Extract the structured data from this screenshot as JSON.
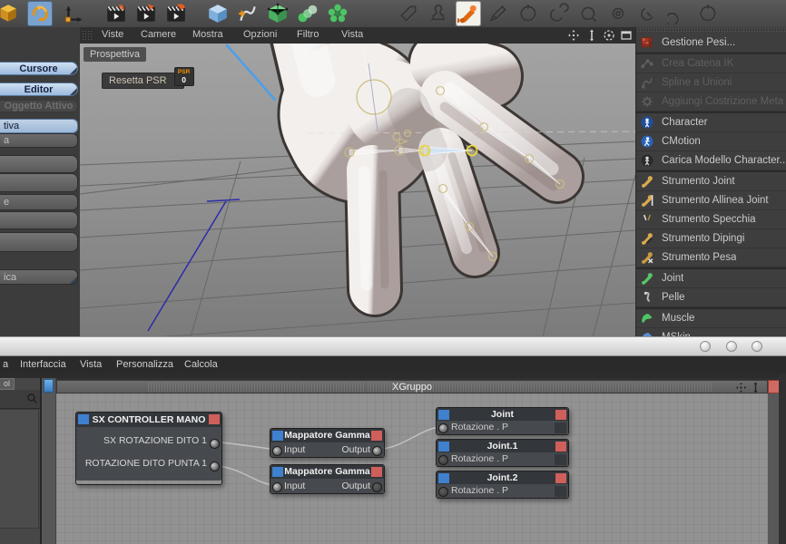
{
  "colors": {
    "accent_blue": "#3f80cf",
    "accent_red": "#cf5f5a",
    "selection_yellow": "#e8d23c",
    "ik_blue": "#4aa0e8"
  },
  "toolbar": {
    "left_icons": [
      {
        "name": "polygon-mode-icon",
        "icon": "ycube"
      },
      {
        "name": "rotate-tool-icon",
        "icon": "rotate",
        "selected": true
      },
      {
        "name": "move-axis-tool-icon",
        "icon": "move"
      },
      {
        "name": "record-position-icon",
        "icon": "clap1"
      },
      {
        "name": "record-scale-icon",
        "icon": "clap2"
      },
      {
        "name": "record-rotation-icon",
        "icon": "clap3"
      },
      {
        "name": "cube-primitive-icon",
        "icon": "bcube"
      },
      {
        "name": "add-spline-icon",
        "icon": "spline"
      },
      {
        "name": "hypernurbs-icon",
        "icon": "cage"
      },
      {
        "name": "array-object-icon",
        "icon": "array"
      },
      {
        "name": "cluster-object-icon",
        "icon": "cluster"
      }
    ],
    "right_icons": [
      {
        "name": "pose-tag-icon",
        "icon": "tag"
      },
      {
        "name": "morph-tag-icon",
        "icon": "stamp"
      },
      {
        "name": "joint-tool-active-icon",
        "icon": "bonew",
        "selected_white": true
      },
      {
        "name": "pencil-tool-icon",
        "icon": "pencil"
      },
      {
        "name": "circle-tool-1-icon",
        "icon": "c1"
      },
      {
        "name": "circle-tool-2-icon",
        "icon": "c2"
      },
      {
        "name": "circle-tool-3-icon",
        "icon": "c3"
      },
      {
        "name": "ring-tool-1-icon",
        "icon": "r1"
      },
      {
        "name": "ring-tool-2-icon",
        "icon": "r2"
      },
      {
        "name": "ring-tool-3-icon",
        "icon": "r3"
      },
      {
        "name": "ring-tool-4-icon",
        "icon": "c1"
      }
    ]
  },
  "left_panel": {
    "buttons": [
      {
        "label": "Cursore",
        "kind": "blue",
        "fold": true
      },
      {
        "label": "Editor",
        "kind": "blue",
        "fold": true
      },
      {
        "label": "Oggetto Attivo",
        "kind": "dis"
      },
      {
        "label": "tiva",
        "kind": "sel"
      },
      {
        "label": "a",
        "kind": "row"
      },
      {
        "label": "",
        "kind": "empty"
      },
      {
        "label": "",
        "kind": "empty"
      },
      {
        "label": "e",
        "kind": "row"
      },
      {
        "label": "",
        "kind": "empty"
      },
      {
        "label": "",
        "kind": "empty"
      },
      {
        "label": "ica",
        "kind": "row",
        "fold": true
      }
    ]
  },
  "viewport": {
    "menu": [
      "Viste",
      "Camere",
      "Mostra",
      "Opzioni",
      "Filtro",
      "Vista"
    ],
    "nav_icons": [
      "pan-view-icon",
      "zoom-view-icon",
      "rotate-view-icon",
      "maximize-view-icon"
    ],
    "view_label": "Prospettiva",
    "reset_button": {
      "label": "Resetta PSR",
      "badge_top": "PSR",
      "badge_bottom": "0"
    }
  },
  "sidebar": {
    "items": [
      {
        "label": "Gestione Pesi...",
        "icon": "weights-grid-icon",
        "group_end": true
      },
      {
        "label": "Crea Catena IK",
        "icon": "ik-chain-icon",
        "disabled": true
      },
      {
        "label": "Spline a Unioni",
        "icon": "spline-union-icon",
        "disabled": true
      },
      {
        "label": "Aggiungi Costrizione Meta",
        "icon": "constraint-gear-icon",
        "disabled": true,
        "group_end": true
      },
      {
        "label": "Character",
        "icon": "character-circle-icon"
      },
      {
        "label": "CMotion",
        "icon": "cmotion-circle-icon"
      },
      {
        "label": "Carica Modello Character...",
        "icon": "character-model-icon",
        "group_end": true
      },
      {
        "label": "Strumento Joint",
        "icon": "joint-tool-icon"
      },
      {
        "label": "Strumento Allinea Joint",
        "icon": "joint-align-icon"
      },
      {
        "label": "Strumento Specchia",
        "icon": "mirror-tool-icon"
      },
      {
        "label": "Strumento Dipingi",
        "icon": "paint-tool-icon"
      },
      {
        "label": "Strumento Pesa",
        "icon": "weight-tool-icon",
        "group_end": true
      },
      {
        "label": "Joint",
        "icon": "joint-green-icon"
      },
      {
        "label": "Pelle",
        "icon": "skin-hook-icon",
        "group_end": true
      },
      {
        "label": "Muscle",
        "icon": "muscle-icon"
      },
      {
        "label": "MSkin",
        "icon": "mskin-icon"
      }
    ]
  },
  "xpresso": {
    "menu_prefix": "a",
    "menu": [
      "Interfaccia",
      "Vista",
      "Personalizza",
      "Calcola"
    ],
    "pool_tab": "ol",
    "group_title": "XGruppo",
    "nodes": {
      "controller": {
        "title": "SX CONTROLLER MANO",
        "outputs": [
          "SX ROTAZIONE DITO 1",
          "ROTAZIONE DITO PUNTA 1"
        ]
      },
      "gamma": {
        "title": "Mappatore Gamma",
        "input_label": "Input",
        "output_label": "Output"
      },
      "joints": [
        {
          "title": "Joint",
          "port": "Rotazione . P"
        },
        {
          "title": "Joint.1",
          "port": "Rotazione . P"
        },
        {
          "title": "Joint.2",
          "port": "Rotazione . P"
        }
      ]
    }
  }
}
